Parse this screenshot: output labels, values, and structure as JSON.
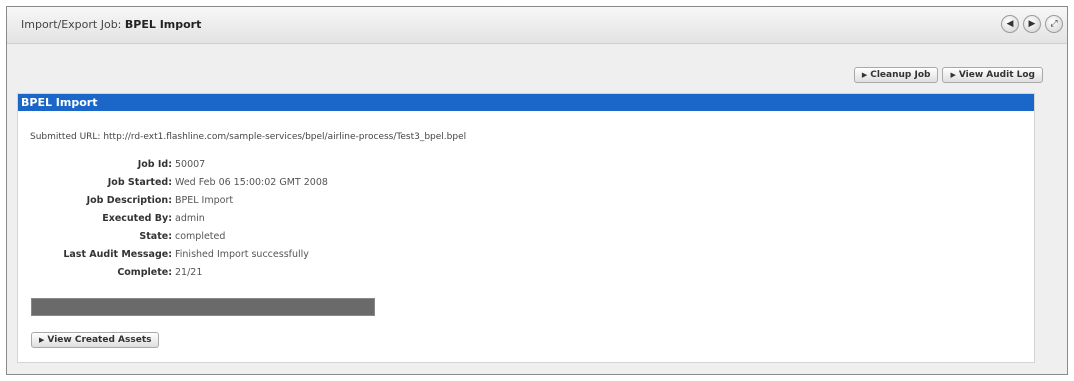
{
  "title": {
    "prefix": "Import/Export Job:",
    "name": "BPEL Import"
  },
  "nav": [
    "◀",
    "▶",
    "⤢"
  ],
  "actions": {
    "cleanup": "Cleanup Job",
    "audit": "View Audit Log"
  },
  "panel": {
    "header": "BPEL Import",
    "url_text": "Submitted URL: http://rd-ext1.flashline.com/sample-services/bpel/airline-process/Test3_bpel.bpel"
  },
  "details": [
    {
      "label": "Job Id:",
      "value": "50007"
    },
    {
      "label": "Job Started:",
      "value": "Wed Feb 06 15:00:02 GMT 2008"
    },
    {
      "label": "Job Description:",
      "value": "BPEL Import"
    },
    {
      "label": "Executed By:",
      "value": "admin"
    },
    {
      "label": "State:",
      "value": "completed"
    },
    {
      "label": "Last Audit Message:",
      "value": "Finished Import successfully"
    },
    {
      "label": "Complete:",
      "value": "21/21"
    }
  ],
  "progress": {
    "fraction": 1.0
  },
  "created_button": "View Created Assets",
  "colors": {
    "header_bg": "#1a66c9",
    "progress_fill": "#6a6a6a"
  }
}
